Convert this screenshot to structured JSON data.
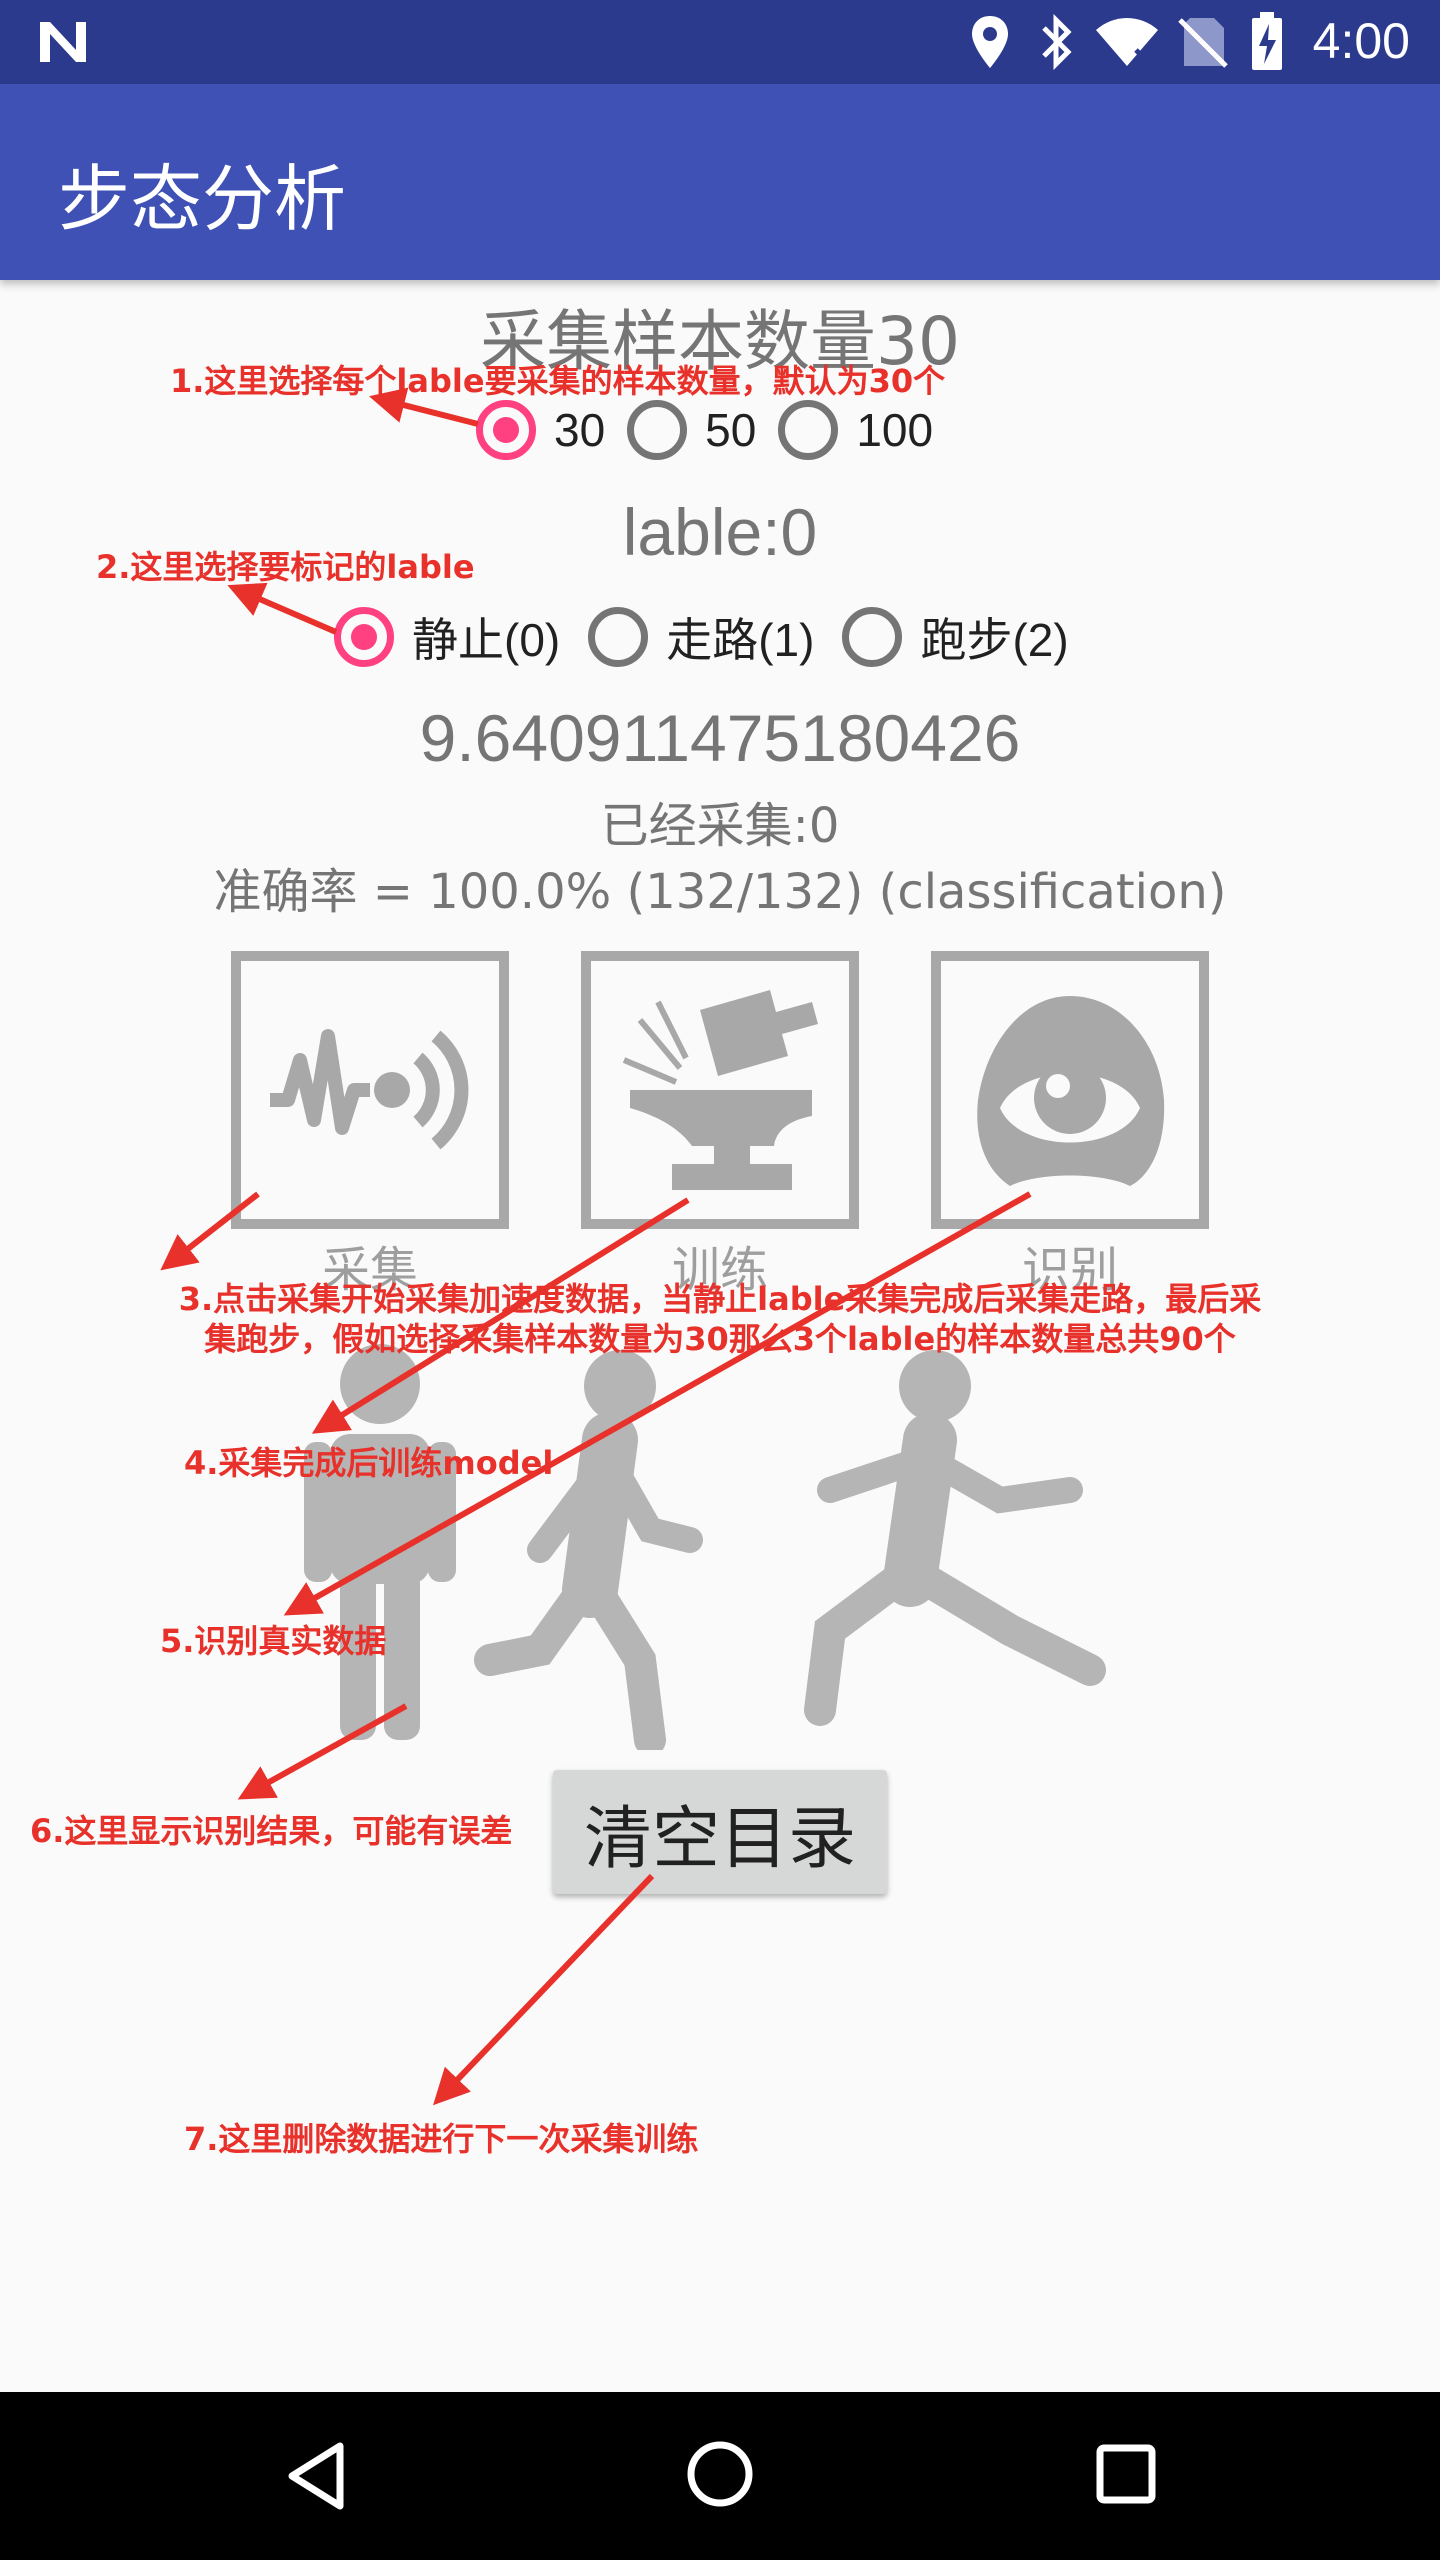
{
  "status_bar": {
    "time": "4:00"
  },
  "app_bar": {
    "title": "步态分析"
  },
  "sample_count": {
    "heading": "采集样本数量30",
    "options": [
      {
        "label": "30",
        "checked": true
      },
      {
        "label": "50",
        "checked": false
      },
      {
        "label": "100",
        "checked": false
      }
    ]
  },
  "label_section": {
    "heading": "lable:0",
    "options": [
      {
        "label": "静止(0)",
        "checked": true
      },
      {
        "label": "走路(1)",
        "checked": false
      },
      {
        "label": "跑步(2)",
        "checked": false
      }
    ]
  },
  "sensor_value": "9.640911475180426",
  "collected": "已经采集:0",
  "accuracy": "准确率 = 100.0% (132/132) (classification)",
  "actions": [
    {
      "label": "采集",
      "icon": "sensor-wave-icon"
    },
    {
      "label": "训练",
      "icon": "anvil-hammer-icon"
    },
    {
      "label": "识别",
      "icon": "eye-icon"
    }
  ],
  "clear_button": {
    "label": "清空目录"
  },
  "annotations": {
    "a1": "1.这里选择每个lable要采集的样本数量，默认为30个",
    "a2": "2.这里选择要标记的lable",
    "a3_line1": "3.点击采集开始采集加速度数据，当静止lable采集完成后采集走路，最后采",
    "a3_line2": "集跑步，假如选择采集样本数量为30那么3个lable的样本数量总共90个",
    "a4": "4.采集完成后训练model",
    "a5": "5.识别真实数据",
    "a6": "6.这里显示识别结果，可能有误差",
    "a7": "7.这里删除数据进行下一次采集训练"
  },
  "colors": {
    "primary": "#3f51b5",
    "primary_dark": "#2c3a8e",
    "accent": "#ff4081",
    "annotation": "#e8312a"
  }
}
